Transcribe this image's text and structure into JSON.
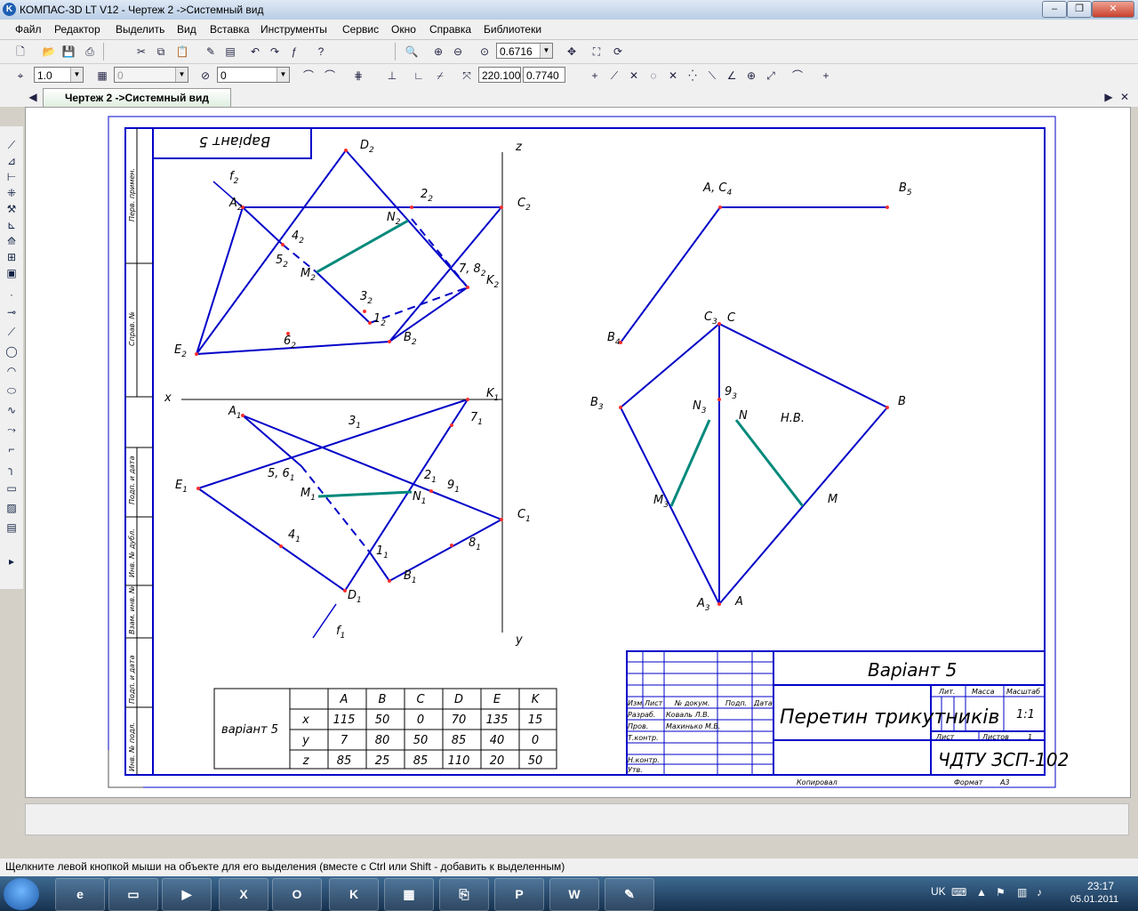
{
  "window": {
    "title": "КОМПАС-3D LT V12 - Чертеж 2 ->Системный вид",
    "minimize": "‒",
    "restore": "❐",
    "close": "✕"
  },
  "menu": [
    "Файл",
    "Редактор",
    "Выделить",
    "Вид",
    "Вставка",
    "Инструменты",
    "Сервис",
    "Окно",
    "Справка",
    "Библиотеки"
  ],
  "toolbar1": {
    "zoom": "0.6716"
  },
  "toolbar2": {
    "step": "1.0",
    "layer": "0",
    "style": "0",
    "coord_x": "220.100",
    "coord_y": "0.7740"
  },
  "doc_tab": "Чертеж 2 ->Системный вид",
  "drawing": {
    "variant_stamp": "Bapiант 5",
    "frame_labels": [
      "Перв. примен.",
      "Справ. №",
      "Подп. и дата",
      "Инв. № дубл.",
      "Взам. инв. №",
      "Подп. и дата",
      "Инв. № подл."
    ],
    "axes": {
      "z": "z",
      "x": "x",
      "y": "y"
    },
    "points_front": {
      "D2": "D",
      "A2": "A",
      "C2": "C",
      "E2": "E",
      "B2": "B",
      "K2": "K",
      "f2": "f",
      "p22": "2",
      "p42": "4",
      "p52": "5",
      "N2": "N",
      "M2": "M",
      "p32": "3",
      "p12": "1",
      "p62": "6",
      "p72": "7, 8"
    },
    "points_top": {
      "K1": "K",
      "A1": "A",
      "E1": "E",
      "C1": "C",
      "D1": "D",
      "B1": "B",
      "f1": "f",
      "p31": "3",
      "p71": "7",
      "p51": "5, 6",
      "M1": "M",
      "N1": "N",
      "p21": "2",
      "p91": "9",
      "p41": "4",
      "p11": "1",
      "p81": "8"
    },
    "points_side": {
      "A4C4": "A, C",
      "B5": "B",
      "B4": "B",
      "C3": "C",
      "C": "C",
      "B3": "B",
      "B": "B",
      "p93": "9",
      "N3": "N",
      "N": "N",
      "NV": "Н.В.",
      "M3": "M",
      "M": "M",
      "A3": "A",
      "A": "A"
    },
    "coords_table": {
      "label": "варiант 5",
      "columns": [
        "A",
        "B",
        "C",
        "D",
        "E",
        "K"
      ],
      "rows": [
        {
          "axis": "x",
          "values": [
            "115",
            "50",
            "0",
            "70",
            "135",
            "15"
          ]
        },
        {
          "axis": "y",
          "values": [
            "7",
            "80",
            "50",
            "85",
            "40",
            "0"
          ]
        },
        {
          "axis": "z",
          "values": [
            "85",
            "25",
            "85",
            "110",
            "20",
            "50"
          ]
        }
      ]
    },
    "title_block": {
      "variant": "Варiант 5",
      "name": "Перетин трикутникiв",
      "code": "ЧДТУ ЗСП-102",
      "lit": "Лит.",
      "mass": "Масса",
      "scale_label": "Масштаб",
      "scale": "1:1",
      "sheet": "Лист",
      "sheets": "Листов",
      "sheets_count": "1",
      "hdr": [
        "Изм.",
        "Лист",
        "№ докум.",
        "Подп.",
        "Дата"
      ],
      "roles": [
        "Разраб.",
        "Пров.",
        "Т.контр.",
        "Н.контр.",
        "Утв."
      ],
      "people": [
        "Коваль Л.В.",
        "Махинько М.В."
      ],
      "copied": "Копировал",
      "format": "Формат",
      "format_val": "A3"
    }
  },
  "status": "Щелкните левой кнопкой мыши на объекте для его выделения (вместе с Ctrl или Shift - добавить к выделенным)",
  "taskbar": {
    "lang": "UK",
    "time": "23:17",
    "date": "05.01.2011"
  },
  "colors": {
    "lines": "#0000c8",
    "section": "#00897b",
    "points": "#ff3030"
  }
}
